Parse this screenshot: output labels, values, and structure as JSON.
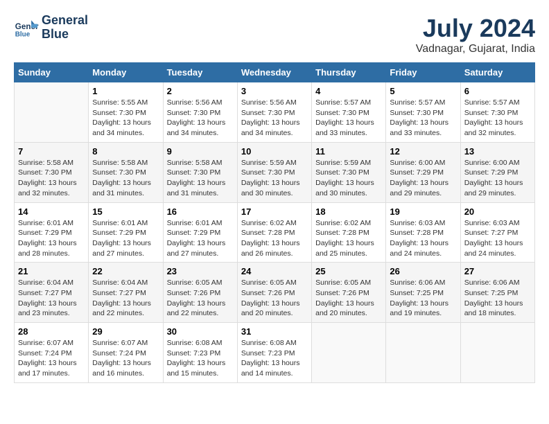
{
  "header": {
    "logo_line1": "General",
    "logo_line2": "Blue",
    "month": "July 2024",
    "location": "Vadnagar, Gujarat, India"
  },
  "days_of_week": [
    "Sunday",
    "Monday",
    "Tuesday",
    "Wednesday",
    "Thursday",
    "Friday",
    "Saturday"
  ],
  "weeks": [
    [
      {
        "day": "",
        "info": ""
      },
      {
        "day": "1",
        "info": "Sunrise: 5:55 AM\nSunset: 7:30 PM\nDaylight: 13 hours and 34 minutes."
      },
      {
        "day": "2",
        "info": "Sunrise: 5:56 AM\nSunset: 7:30 PM\nDaylight: 13 hours and 34 minutes."
      },
      {
        "day": "3",
        "info": "Sunrise: 5:56 AM\nSunset: 7:30 PM\nDaylight: 13 hours and 34 minutes."
      },
      {
        "day": "4",
        "info": "Sunrise: 5:57 AM\nSunset: 7:30 PM\nDaylight: 13 hours and 33 minutes."
      },
      {
        "day": "5",
        "info": "Sunrise: 5:57 AM\nSunset: 7:30 PM\nDaylight: 13 hours and 33 minutes."
      },
      {
        "day": "6",
        "info": "Sunrise: 5:57 AM\nSunset: 7:30 PM\nDaylight: 13 hours and 32 minutes."
      }
    ],
    [
      {
        "day": "7",
        "info": "Sunrise: 5:58 AM\nSunset: 7:30 PM\nDaylight: 13 hours and 32 minutes."
      },
      {
        "day": "8",
        "info": "Sunrise: 5:58 AM\nSunset: 7:30 PM\nDaylight: 13 hours and 31 minutes."
      },
      {
        "day": "9",
        "info": "Sunrise: 5:58 AM\nSunset: 7:30 PM\nDaylight: 13 hours and 31 minutes."
      },
      {
        "day": "10",
        "info": "Sunrise: 5:59 AM\nSunset: 7:30 PM\nDaylight: 13 hours and 30 minutes."
      },
      {
        "day": "11",
        "info": "Sunrise: 5:59 AM\nSunset: 7:30 PM\nDaylight: 13 hours and 30 minutes."
      },
      {
        "day": "12",
        "info": "Sunrise: 6:00 AM\nSunset: 7:29 PM\nDaylight: 13 hours and 29 minutes."
      },
      {
        "day": "13",
        "info": "Sunrise: 6:00 AM\nSunset: 7:29 PM\nDaylight: 13 hours and 29 minutes."
      }
    ],
    [
      {
        "day": "14",
        "info": "Sunrise: 6:01 AM\nSunset: 7:29 PM\nDaylight: 13 hours and 28 minutes."
      },
      {
        "day": "15",
        "info": "Sunrise: 6:01 AM\nSunset: 7:29 PM\nDaylight: 13 hours and 27 minutes."
      },
      {
        "day": "16",
        "info": "Sunrise: 6:01 AM\nSunset: 7:29 PM\nDaylight: 13 hours and 27 minutes."
      },
      {
        "day": "17",
        "info": "Sunrise: 6:02 AM\nSunset: 7:28 PM\nDaylight: 13 hours and 26 minutes."
      },
      {
        "day": "18",
        "info": "Sunrise: 6:02 AM\nSunset: 7:28 PM\nDaylight: 13 hours and 25 minutes."
      },
      {
        "day": "19",
        "info": "Sunrise: 6:03 AM\nSunset: 7:28 PM\nDaylight: 13 hours and 24 minutes."
      },
      {
        "day": "20",
        "info": "Sunrise: 6:03 AM\nSunset: 7:27 PM\nDaylight: 13 hours and 24 minutes."
      }
    ],
    [
      {
        "day": "21",
        "info": "Sunrise: 6:04 AM\nSunset: 7:27 PM\nDaylight: 13 hours and 23 minutes."
      },
      {
        "day": "22",
        "info": "Sunrise: 6:04 AM\nSunset: 7:27 PM\nDaylight: 13 hours and 22 minutes."
      },
      {
        "day": "23",
        "info": "Sunrise: 6:05 AM\nSunset: 7:26 PM\nDaylight: 13 hours and 22 minutes."
      },
      {
        "day": "24",
        "info": "Sunrise: 6:05 AM\nSunset: 7:26 PM\nDaylight: 13 hours and 20 minutes."
      },
      {
        "day": "25",
        "info": "Sunrise: 6:05 AM\nSunset: 7:26 PM\nDaylight: 13 hours and 20 minutes."
      },
      {
        "day": "26",
        "info": "Sunrise: 6:06 AM\nSunset: 7:25 PM\nDaylight: 13 hours and 19 minutes."
      },
      {
        "day": "27",
        "info": "Sunrise: 6:06 AM\nSunset: 7:25 PM\nDaylight: 13 hours and 18 minutes."
      }
    ],
    [
      {
        "day": "28",
        "info": "Sunrise: 6:07 AM\nSunset: 7:24 PM\nDaylight: 13 hours and 17 minutes."
      },
      {
        "day": "29",
        "info": "Sunrise: 6:07 AM\nSunset: 7:24 PM\nDaylight: 13 hours and 16 minutes."
      },
      {
        "day": "30",
        "info": "Sunrise: 6:08 AM\nSunset: 7:23 PM\nDaylight: 13 hours and 15 minutes."
      },
      {
        "day": "31",
        "info": "Sunrise: 6:08 AM\nSunset: 7:23 PM\nDaylight: 13 hours and 14 minutes."
      },
      {
        "day": "",
        "info": ""
      },
      {
        "day": "",
        "info": ""
      },
      {
        "day": "",
        "info": ""
      }
    ]
  ]
}
